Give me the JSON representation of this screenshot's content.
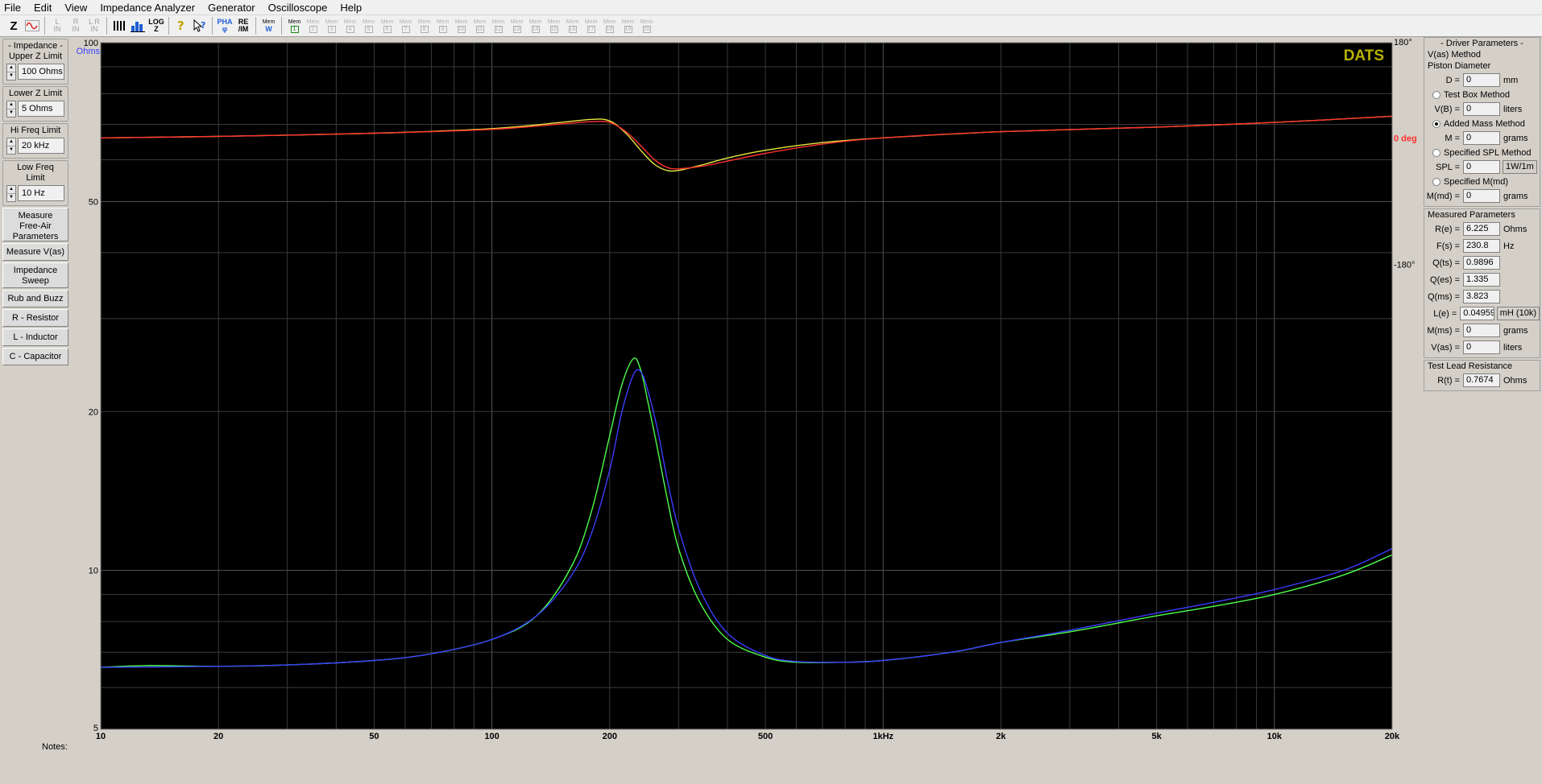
{
  "menu": [
    "File",
    "Edit",
    "View",
    "Impedance Analyzer",
    "Generator",
    "Oscilloscope",
    "Help"
  ],
  "toolbar": {
    "z_label": "Z",
    "l_in": "L\nIN",
    "r_in": "R\nIN",
    "lr_in": "L R\nIN",
    "log_label": "LOG\nZ",
    "pha_label": "PHA\nφ",
    "reim_label": "RE\n/IM",
    "mem_label": "Mem",
    "mem_numbers": [
      "1",
      "2",
      "3",
      "4",
      "5",
      "6",
      "7",
      "8",
      "9",
      "10",
      "11",
      "12",
      "13",
      "14",
      "15",
      "16",
      "17",
      "18",
      "19",
      "20"
    ]
  },
  "left": {
    "impedance_title": "- Impedance -",
    "upper_z_label": "Upper Z Limit",
    "upper_z_value": "100 Ohms",
    "lower_z_label": "Lower Z Limit",
    "lower_z_value": "5 Ohms",
    "hi_freq_label": "Hi Freq Limit",
    "hi_freq_value": "20 kHz",
    "low_freq_label": "Low Freq Limit",
    "low_freq_value": "10 Hz",
    "buttons": [
      "Measure\nFree-Air\nParameters",
      "Measure V(as)",
      "Impedance\nSweep",
      "Rub and Buzz",
      "R - Resistor",
      "L - Inductor",
      "C - Capacitor"
    ]
  },
  "right": {
    "driver_title": "- Driver Parameters -",
    "vas_method": "V(as) Method",
    "piston_diameter": "Piston Diameter",
    "d_label": "D =",
    "d_value": "0",
    "d_unit": "mm",
    "test_box": "Test Box Method",
    "vb_label": "V(B) =",
    "vb_value": "0",
    "vb_unit": "liters",
    "added_mass": "Added Mass Method",
    "m_label": "M =",
    "m_value": "0",
    "m_unit": "grams",
    "specified_spl": "Specified SPL Method",
    "spl_label": "SPL =",
    "spl_value": "0",
    "spl_unit": "1W/1m",
    "specified_mmd": "Specified M(md)",
    "mmd_label": "M(md) =",
    "mmd_value": "0",
    "mmd_unit": "grams",
    "measured_title": "Measured Parameters",
    "params": [
      {
        "label": "R(e) =",
        "value": "6.225",
        "unit": "Ohms"
      },
      {
        "label": "F(s) =",
        "value": "230.8",
        "unit": "Hz"
      },
      {
        "label": "Q(ts) =",
        "value": "0.9896",
        "unit": ""
      },
      {
        "label": "Q(es) =",
        "value": "1.335",
        "unit": ""
      },
      {
        "label": "Q(ms) =",
        "value": "3.823",
        "unit": ""
      },
      {
        "label": "L(e) =",
        "value": "0.04959",
        "unit": "mH (10k)"
      },
      {
        "label": "M(ms) =",
        "value": "0",
        "unit": "grams"
      },
      {
        "label": "V(as) =",
        "value": "0",
        "unit": "liters"
      }
    ],
    "lead_title": "Test Lead Resistance",
    "rt_label": "R(t) =",
    "rt_value": "0.7674",
    "rt_unit": "Ohms"
  },
  "notes_label": "Notes:",
  "colors": {
    "plot_bg": "#000000",
    "grid": "#3a3a3a",
    "impedance_blue": "#3c3cff",
    "impedance_green": "#4cff4c",
    "phase_red": "#ff3030",
    "phase_yellow": "#e8e840",
    "brand": "#b8b000",
    "ohms_label": "#3c3cff",
    "deg_label": "#ff3030"
  },
  "chart_data": {
    "type": "line",
    "brand": "DATS",
    "y_unit_label": "Ohms",
    "x_scale": "log",
    "y_scale": "log",
    "xlim": [
      10,
      20000
    ],
    "ylim": [
      5,
      100
    ],
    "x_ticks": [
      {
        "v": 10,
        "label": "10"
      },
      {
        "v": 20,
        "label": "20"
      },
      {
        "v": 50,
        "label": "50"
      },
      {
        "v": 100,
        "label": "100"
      },
      {
        "v": 200,
        "label": "200"
      },
      {
        "v": 500,
        "label": "500"
      },
      {
        "v": 1000,
        "label": "1kHz"
      },
      {
        "v": 2000,
        "label": "2k"
      },
      {
        "v": 5000,
        "label": "5k"
      },
      {
        "v": 10000,
        "label": "10k"
      },
      {
        "v": 20000,
        "label": "20k"
      }
    ],
    "y_ticks": [
      {
        "v": 100,
        "label": "100"
      },
      {
        "v": 50,
        "label": "50"
      },
      {
        "v": 20,
        "label": "20"
      },
      {
        "v": 10,
        "label": "10"
      },
      {
        "v": 5,
        "label": "5"
      }
    ],
    "phase_axis": {
      "range": [
        -180,
        180
      ],
      "ticks": [
        {
          "v": 180,
          "label": "180°"
        },
        {
          "v": 0,
          "label": "0 deg"
        },
        {
          "v": -180,
          "label": "-180°"
        }
      ]
    },
    "series": [
      {
        "key": "impedance_blue",
        "axis": "impedance",
        "color": "#3c3cff",
        "x": [
          10,
          13,
          20,
          30,
          50,
          70,
          100,
          130,
          160,
          180,
          200,
          215,
          230,
          240,
          250,
          265,
          280,
          300,
          340,
          400,
          500,
          600,
          800,
          1000,
          1500,
          2000,
          3000,
          5000,
          7000,
          10000,
          15000,
          20000
        ],
        "y": [
          6.55,
          6.56,
          6.58,
          6.62,
          6.75,
          6.95,
          7.4,
          8.2,
          9.8,
          11.8,
          15.5,
          20.0,
          23.5,
          23.8,
          22.0,
          18.5,
          15.0,
          12.0,
          9.2,
          7.6,
          6.9,
          6.72,
          6.7,
          6.75,
          7.0,
          7.3,
          7.7,
          8.3,
          8.7,
          9.2,
          10.0,
          11.0
        ]
      },
      {
        "key": "impedance_green",
        "axis": "impedance",
        "color": "#4cff4c",
        "x": [
          10,
          13,
          20,
          30,
          50,
          70,
          100,
          130,
          160,
          180,
          200,
          215,
          230,
          240,
          250,
          265,
          280,
          300,
          340,
          400,
          500,
          600,
          800,
          1000,
          1500,
          2000,
          3000,
          5000,
          7000,
          10000,
          15000,
          20000
        ],
        "y": [
          6.55,
          6.6,
          6.58,
          6.62,
          6.75,
          6.95,
          7.4,
          8.2,
          10.2,
          13.0,
          18.0,
          22.5,
          25.2,
          24.0,
          21.0,
          17.0,
          13.8,
          11.0,
          8.7,
          7.4,
          6.85,
          6.7,
          6.7,
          6.75,
          7.0,
          7.3,
          7.65,
          8.2,
          8.55,
          9.0,
          9.8,
          10.7
        ]
      },
      {
        "key": "phase_yellow",
        "axis": "phase",
        "color": "#e8e840",
        "x": [
          10,
          20,
          50,
          100,
          150,
          180,
          200,
          220,
          240,
          260,
          280,
          300,
          350,
          400,
          500,
          700,
          1000,
          2000,
          5000,
          10000,
          20000
        ],
        "y": [
          0,
          1,
          3,
          6,
          10,
          12,
          11,
          3,
          -8,
          -17,
          -21,
          -21,
          -17,
          -13,
          -8,
          -3,
          0,
          4,
          7,
          10,
          14
        ]
      },
      {
        "key": "phase_red",
        "axis": "phase",
        "color": "#ff3030",
        "x": [
          10,
          20,
          50,
          100,
          150,
          180,
          200,
          220,
          240,
          260,
          280,
          300,
          350,
          400,
          500,
          700,
          1000,
          2000,
          5000,
          10000,
          20000
        ],
        "y": [
          0,
          1,
          3,
          5.5,
          9,
          10.5,
          10,
          4,
          -5,
          -14,
          -19,
          -20,
          -18,
          -15,
          -10,
          -4,
          0,
          4,
          7,
          10,
          14
        ]
      }
    ]
  }
}
